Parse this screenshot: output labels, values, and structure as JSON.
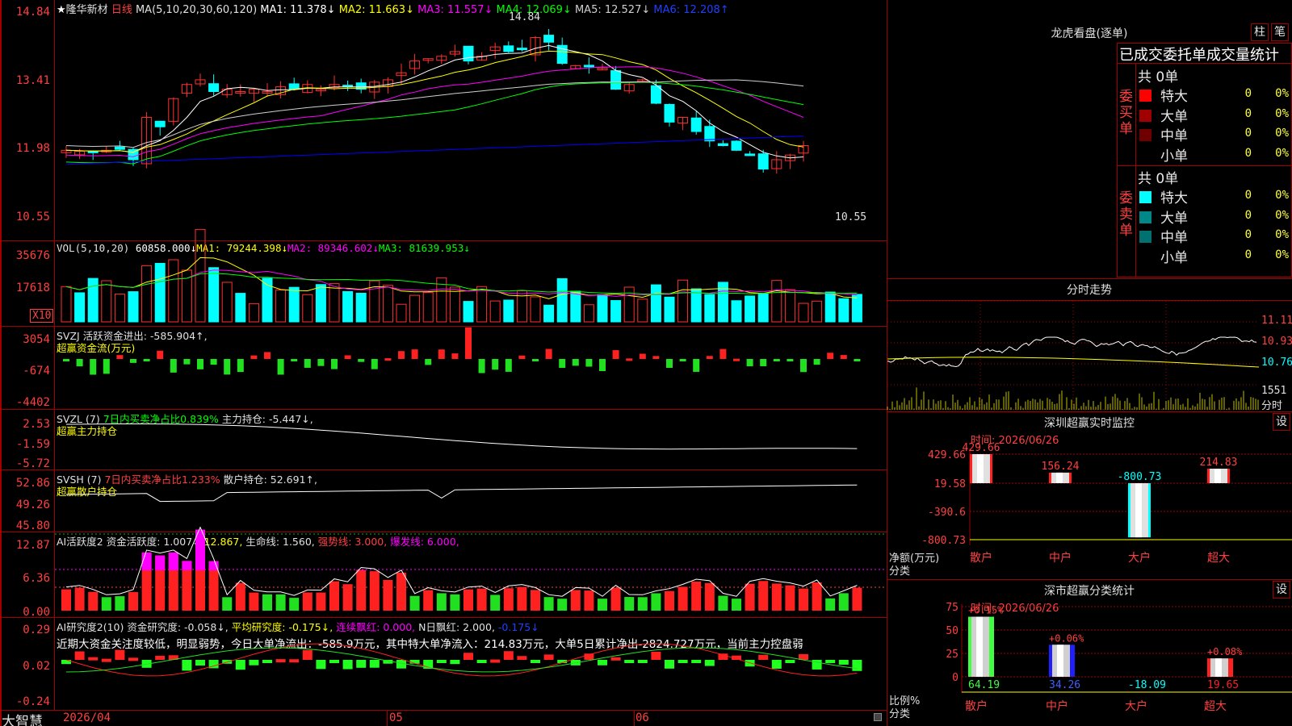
{
  "stock": {
    "star": "★",
    "name": "隆华新材",
    "period": "日线"
  },
  "main_chart": {
    "ma_params": "MA(5,10,20,30,60,120)",
    "ma1": "MA1: 11.378↓",
    "ma2": "MA2: 11.663↓",
    "ma3": "MA3: 11.557↓",
    "ma4": "MA4: 12.069↓",
    "ma5": "MA5: 12.527↓",
    "ma6": "MA6: 12.208↑",
    "y_labels": [
      "14.84",
      "13.41",
      "11.98",
      "10.55"
    ],
    "high_label": "14.84",
    "low_label": "10.55",
    "colors": {
      "ma1": "#ffffff",
      "ma2": "#ffff00",
      "ma3": "#ff00ff",
      "ma4": "#00ff00",
      "ma5": "#d0d0d0",
      "ma6": "#0000ff",
      "up": "#ff3030",
      "down": "#00ffff"
    }
  },
  "vol": {
    "title": "VOL(5,10,20)",
    "value": "60858.000↓",
    "ma1": "MA1: 79244.398↓",
    "ma2": "MA2: 89346.602↓",
    "ma3": "MA3: 81639.953↓",
    "y_labels": [
      "35676",
      "17618"
    ],
    "unit": "X10"
  },
  "svzj": {
    "title": "SVZJ",
    "line1": "活跃资金进出: -585.904↑,",
    "line2": "超赢资金流(万元)",
    "y_labels": [
      "3054",
      "-674",
      "-4402"
    ]
  },
  "svzl": {
    "title": "SVZL (7)",
    "t1": "7日内买卖净占比0.839%",
    "t2": "主力持仓: -5.447↓,",
    "line2": "超赢主力持仓",
    "y_labels": [
      "2.53",
      "-1.59",
      "-5.72"
    ]
  },
  "svsh": {
    "title": "SVSH (7)",
    "t1": "7日内买卖净占比1.233%",
    "t2": "散户持仓: 52.691↑,",
    "line2": "超赢散户持仓",
    "y_labels": [
      "52.86",
      "49.26",
      "45.80"
    ]
  },
  "ai1": {
    "title": "AI活跃度2",
    "t1": "资金活跃度: 1.007↓,",
    "t2": "12.867,",
    "t3": "生命线: 1.560,",
    "t4": "强势线: 3.000,",
    "t5": "爆发线: 6.000,",
    "y_labels": [
      "12.87",
      "6.36",
      "0.00"
    ]
  },
  "ai2": {
    "title": "AI研究度2(10)",
    "t1": "资金研究度: -0.058↓,",
    "t2": "平均研究度: -0.175↓,",
    "t3": "连续飘红: 0.000,",
    "t4": "N日飘红: 2.000,",
    "t5": "-0.175↓",
    "note": "近期大资金关注度较低，明显弱势，今日大单净流出：-585.9万元，其中特大单净流入：214.83万元，大单5日累计净出-2824.727万元，当前主力控盘弱",
    "y_labels": [
      "0.29",
      "0.02",
      "-0.24"
    ]
  },
  "footer": {
    "brand": "大智慧",
    "date1": "2026/04",
    "date2": "05",
    "date3": "06"
  },
  "dragon": {
    "title": "龙虎看盘(逐单)",
    "btn1": "柱",
    "btn2": "笔",
    "subtitle": "已成交委托单成交量统计",
    "buy_total": "共 0单",
    "buy_side": "委买单",
    "sell_total": "共 0单",
    "sell_side": "委卖单",
    "rows_buy": [
      {
        "label": "特大",
        "count": "0",
        "pct": "0%",
        "color": "#ff0000"
      },
      {
        "label": "大单",
        "count": "0",
        "pct": "0%",
        "color": "#a00000"
      },
      {
        "label": "中单",
        "count": "0",
        "pct": "0%",
        "color": "#700000"
      },
      {
        "label": "小单",
        "count": "0",
        "pct": "0%",
        "color": "#000000"
      }
    ],
    "rows_sell": [
      {
        "label": "特大",
        "count": "0",
        "pct": "0%",
        "color": "#00ffff"
      },
      {
        "label": "大单",
        "count": "0",
        "pct": "0%",
        "color": "#008888"
      },
      {
        "label": "中单",
        "count": "0",
        "pct": "0%",
        "color": "#007070"
      },
      {
        "label": "小单",
        "count": "0",
        "pct": "0%",
        "color": "#000000"
      }
    ]
  },
  "intraday": {
    "title": "分时走势",
    "y_labels": [
      "11.11",
      "10.93",
      "10.76",
      "1551"
    ],
    "vol_label": "分时"
  },
  "sz_monitor": {
    "title": "深圳超赢实时监控",
    "btn": "设",
    "time": "时间: 2026/06/26",
    "y_labels": [
      "429.66",
      "19.58",
      "-390.6",
      "-800.73"
    ],
    "ylabel1": "净额(万元)",
    "ylabel2": "分类",
    "bars": [
      {
        "cat": "散户",
        "value": 429.66,
        "label": "429.66"
      },
      {
        "cat": "中户",
        "value": 156.24,
        "label": "156.24"
      },
      {
        "cat": "大户",
        "value": -800.73,
        "label": "-800.73"
      },
      {
        "cat": "超大",
        "value": 214.83,
        "label": "214.83"
      }
    ]
  },
  "sz_class": {
    "title": "深市超赢分类统计",
    "btn": "设",
    "time": "时间: 2026/06/26",
    "y_labels": [
      "75",
      "50",
      "25",
      "0"
    ],
    "ylabel1": "比例%",
    "ylabel2": "分类",
    "bars": [
      {
        "cat": "散户",
        "value": 64.19,
        "top": "+0.15%",
        "bottom": "64.19"
      },
      {
        "cat": "中户",
        "value": 34.26,
        "top": "+0.06%",
        "bottom": "34.26"
      },
      {
        "cat": "大户",
        "value": -18.09,
        "top": "",
        "bottom": "-18.09"
      },
      {
        "cat": "超大",
        "value": 19.65,
        "top": "+0.08%",
        "bottom": "19.65"
      }
    ]
  }
}
